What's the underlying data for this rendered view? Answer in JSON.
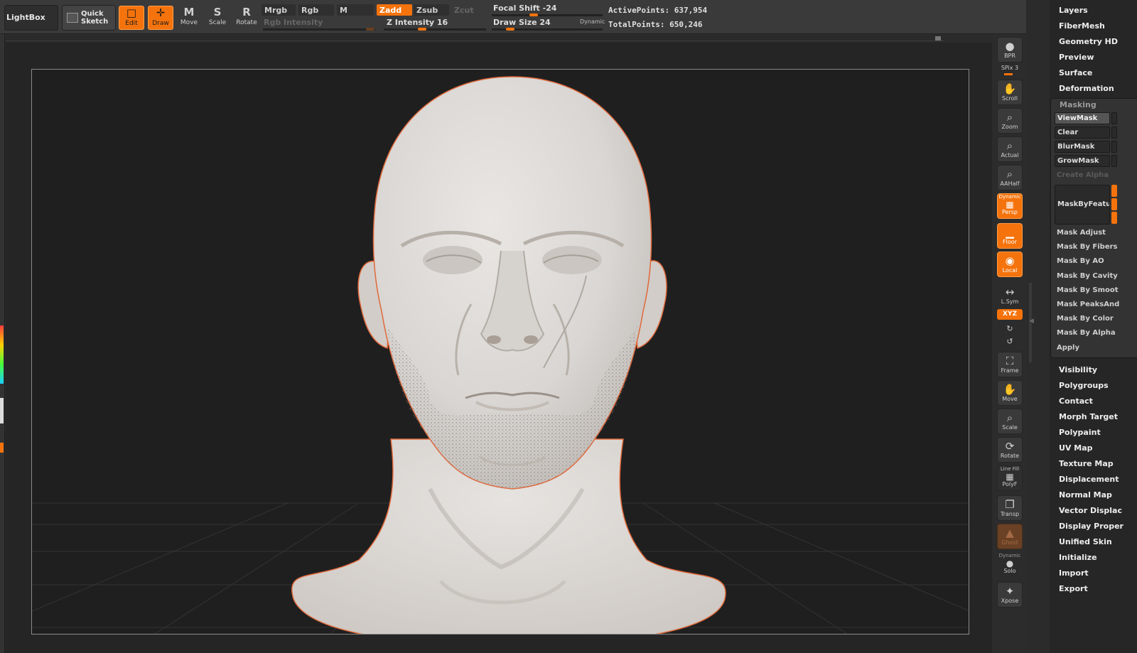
{
  "toolbar": {
    "lightbox": "LightBox",
    "quick_sketch": "Quick\nSketch",
    "edit": "Edit",
    "draw": "Draw",
    "move": "Move",
    "scale": "Scale",
    "rotate": "Rotate",
    "mrgb": "Mrgb",
    "rgb": "Rgb",
    "m": "M",
    "zadd": "Zadd",
    "zsub": "Zsub",
    "zcut": "Zcut",
    "rgb_intensity": "Rgb Intensity",
    "z_intensity": "Z Intensity 16",
    "focal_shift": "Focal Shift -24",
    "draw_size": "Draw Size 24",
    "dynamic": "Dynamic",
    "active_points": "ActivePoints: 637,954",
    "total_points": "TotalPoints: 650,246"
  },
  "right_toolbar": {
    "bpr": "BPR",
    "spix": "SPix 3",
    "scroll": "Scroll",
    "zoom": "Zoom",
    "actual": "Actual",
    "aahalf": "AAHalf",
    "persp_top": "Dynamic",
    "persp": "Persp",
    "floor": "Floor",
    "local": "Local",
    "lsym": "L.Sym",
    "xyz": "XYZ",
    "frame": "Frame",
    "move": "Move",
    "scale": "Scale",
    "rotate": "Rotate",
    "polyf_top": "Line Fill",
    "polyf": "PolyF",
    "transp": "Transp",
    "ghost": "Ghost",
    "solo_top": "Dynamic",
    "solo": "Solo",
    "xpose": "Xpose"
  },
  "palette": {
    "top_items": [
      "Layers",
      "FiberMesh",
      "Geometry HD",
      "Preview",
      "Surface",
      "Deformation"
    ],
    "masking": {
      "header": "Masking",
      "buttons": [
        "ViewMask",
        "Clear",
        "BlurMask",
        "GrowMask"
      ],
      "create_alpha": "Create Alpha",
      "mask_by_feature": "MaskByFeatur",
      "subitems": [
        "Mask Adjust",
        "Mask By Fibers",
        "Mask By AO",
        "Mask By Cavity",
        "Mask By Smoot",
        "Mask PeaksAnd",
        "Mask By Color",
        "Mask By Alpha"
      ],
      "apply": "Apply"
    },
    "bottom_items": [
      "Visibility",
      "Polygroups",
      "Contact",
      "Morph Target",
      "Polypaint",
      "UV Map",
      "Texture Map",
      "Displacement",
      "Normal Map",
      "Vector Displac",
      "Display Proper",
      "Unified Skin",
      "Initialize",
      "Import",
      "Export"
    ]
  },
  "colors": {
    "accent": "#f5730c",
    "background": "#252525",
    "model": "#d9d6d3",
    "rim": "#e0683a"
  },
  "icons": {
    "edit": "edit-icon",
    "draw": "draw-icon",
    "move": "move-icon",
    "scale": "scale-icon",
    "rotate": "rotate-icon"
  }
}
